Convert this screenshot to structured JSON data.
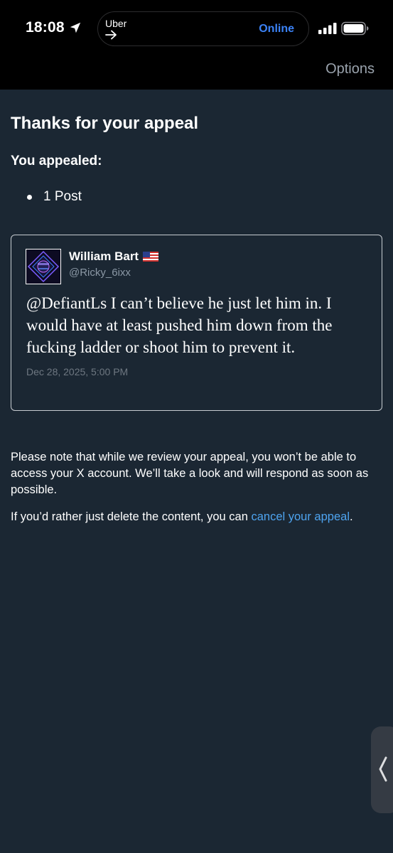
{
  "status_bar": {
    "time": "18:08",
    "location_icon": "location-arrow-icon",
    "island_app": "Uber",
    "island_arrow_icon": "arrow-right-icon",
    "island_status": "Online",
    "signal_icon": "cellular-signal-icon",
    "battery_icon": "battery-icon"
  },
  "header": {
    "options_label": "Options"
  },
  "page": {
    "title": "Thanks for your appeal",
    "subtitle": "You appealed:",
    "appealed_items": [
      "1 Post"
    ]
  },
  "post": {
    "author_name": "William Bart",
    "flag_icon": "us-flag-icon",
    "handle": "@Ricky_6ixx",
    "text": "@DefiantLs I can’t believe he just let him in. I would have at least pushed him down from the fucking ladder or shoot him to prevent it.",
    "date": "Dec 28, 2025, 5:00 PM"
  },
  "notice": {
    "review_text": "Please note that while we review your appeal, you won’t be able to access your X account. We’ll take a look and will respond as soon as possible.",
    "cancel_prefix": "If you’d rather just delete the content, you can ",
    "cancel_link": "cancel your appeal",
    "cancel_suffix": "."
  },
  "colors": {
    "background": "#1b2733",
    "top_bar": "#000000",
    "link": "#4ea4f0",
    "island_status": "#3b82f6",
    "secondary_text": "#8b98a5"
  }
}
